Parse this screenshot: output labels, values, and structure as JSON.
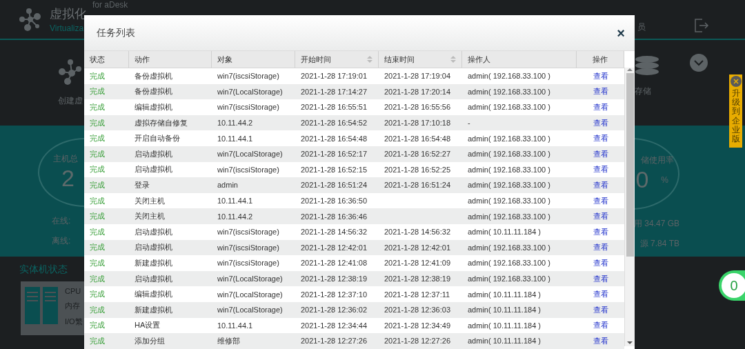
{
  "header": {
    "title": "虚拟化",
    "subtitle": "Virtualiza",
    "edition": "for aDesk",
    "user_label": "员"
  },
  "shortcuts": [
    {
      "label": "创建虚"
    },
    {
      "label": "存储"
    }
  ],
  "stats": {
    "host": {
      "label": "主机总",
      "value": "2",
      "online": "在线:",
      "offline": "离线:"
    },
    "storage": {
      "label": "储使用率",
      "value": "0",
      "unit": "%",
      "used": "用 34.47 GB",
      "total": "源 7.84 TB"
    }
  },
  "host_status": {
    "title": "实体机状态",
    "metrics": [
      "CPU",
      "内存",
      "I/O繁"
    ]
  },
  "upgrade_banner": {
    "text": "升级到企业版"
  },
  "notification_badge": {
    "count": "0"
  },
  "dialog": {
    "title": "任务列表",
    "close": "×",
    "columns": [
      {
        "label": "状态",
        "sortable": false
      },
      {
        "label": "动作",
        "sortable": false
      },
      {
        "label": "对象",
        "sortable": false
      },
      {
        "label": "开始时间",
        "sortable": true
      },
      {
        "label": "结束时间",
        "sortable": true
      },
      {
        "label": "操作人",
        "sortable": false
      },
      {
        "label": "操作",
        "sortable": false
      }
    ],
    "rows": [
      {
        "status": "完成",
        "action": "备份虚拟机",
        "object": "win7(iscsiStorage)",
        "start": "2021-1-28 17:19:01",
        "end": "2021-1-28 17:19:04",
        "operator": "admin( 192.168.33.100 )",
        "link": "查看"
      },
      {
        "status": "完成",
        "action": "备份虚拟机",
        "object": "win7(LocalStorage)",
        "start": "2021-1-28 17:14:27",
        "end": "2021-1-28 17:20:14",
        "operator": "admin( 192.168.33.100 )",
        "link": "查看"
      },
      {
        "status": "完成",
        "action": "编辑虚拟机",
        "object": "win7(iscsiStorage)",
        "start": "2021-1-28 16:55:51",
        "end": "2021-1-28 16:55:56",
        "operator": "admin( 192.168.33.100 )",
        "link": "查看"
      },
      {
        "status": "完成",
        "action": "虚拟存储自修复",
        "object": "10.11.44.2",
        "start": "2021-1-28 16:54:52",
        "end": "2021-1-28 17:10:18",
        "operator": "-",
        "link": "查看"
      },
      {
        "status": "完成",
        "action": "开启自动备份",
        "object": "10.11.44.1",
        "start": "2021-1-28 16:54:48",
        "end": "2021-1-28 16:54:48",
        "operator": "admin( 192.168.33.100 )",
        "link": "查看"
      },
      {
        "status": "完成",
        "action": "启动虚拟机",
        "object": "win7(LocalStorage)",
        "start": "2021-1-28 16:52:17",
        "end": "2021-1-28 16:52:27",
        "operator": "admin( 192.168.33.100 )",
        "link": "查看"
      },
      {
        "status": "完成",
        "action": "启动虚拟机",
        "object": "win7(iscsiStorage)",
        "start": "2021-1-28 16:52:15",
        "end": "2021-1-28 16:52:25",
        "operator": "admin( 192.168.33.100 )",
        "link": "查看"
      },
      {
        "status": "完成",
        "action": "登录",
        "object": "admin",
        "start": "2021-1-28 16:51:24",
        "end": "2021-1-28 16:51:24",
        "operator": "admin( 192.168.33.100 )",
        "link": "查看"
      },
      {
        "status": "完成",
        "action": "关闭主机",
        "object": "10.11.44.1",
        "start": "2021-1-28 16:36:50",
        "operator": "admin( 192.168.33.100 )",
        "link": "查看"
      },
      {
        "status": "完成",
        "action": "关闭主机",
        "object": "10.11.44.2",
        "start": "2021-1-28 16:36:46",
        "operator": "admin( 192.168.33.100 )",
        "link": "查看"
      },
      {
        "status": "完成",
        "action": "启动虚拟机",
        "object": "win7(iscsiStorage)",
        "start": "2021-1-28 14:56:32",
        "end": "2021-1-28 14:56:32",
        "operator": "admin( 10.11.11.184 )",
        "link": "查看"
      },
      {
        "status": "完成",
        "action": "启动虚拟机",
        "object": "win7(iscsiStorage)",
        "start": "2021-1-28 12:42:01",
        "end": "2021-1-28 12:42:01",
        "operator": "admin( 192.168.33.100 )",
        "link": "查看"
      },
      {
        "status": "完成",
        "action": "新建虚拟机",
        "object": "win7(iscsiStorage)",
        "start": "2021-1-28 12:41:08",
        "end": "2021-1-28 12:41:09",
        "operator": "admin( 192.168.33.100 )",
        "link": "查看"
      },
      {
        "status": "完成",
        "action": "启动虚拟机",
        "object": "win7(LocalStorage)",
        "start": "2021-1-28 12:38:19",
        "end": "2021-1-28 12:38:19",
        "operator": "admin( 192.168.33.100 )",
        "link": "查看"
      },
      {
        "status": "完成",
        "action": "编辑虚拟机",
        "object": "win7(LocalStorage)",
        "start": "2021-1-28 12:37:10",
        "end": "2021-1-28 12:37:11",
        "operator": "admin( 10.11.11.184 )",
        "link": "查看"
      },
      {
        "status": "完成",
        "action": "新建虚拟机",
        "object": "win7(LocalStorage)",
        "start": "2021-1-28 12:36:02",
        "end": "2021-1-28 12:36:03",
        "operator": "admin( 10.11.11.184 )",
        "link": "查看"
      },
      {
        "status": "完成",
        "action": "HA设置",
        "object": "10.11.44.1",
        "start": "2021-1-28 12:34:44",
        "end": "2021-1-28 12:34:49",
        "operator": "admin( 10.11.11.184 )",
        "link": "查看"
      },
      {
        "status": "完成",
        "action": "添加分组",
        "object": "维修部",
        "start": "2021-1-28 12:27:26",
        "end": "2021-1-28 12:27:26",
        "operator": "admin( 10.11.11.184 )",
        "link": "查看"
      }
    ]
  }
}
